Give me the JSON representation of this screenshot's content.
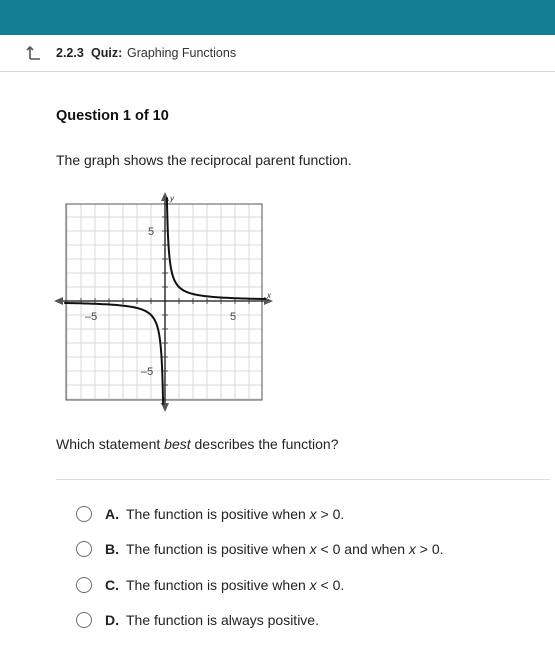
{
  "header": {
    "lesson_number": "2.2.3",
    "quiz_label": "Quiz:",
    "title": "Graphing Functions"
  },
  "question": {
    "heading": "Question 1 of 10",
    "prompt": "The graph shows the reciprocal parent function.",
    "stem_before": "Which statement ",
    "stem_emphasis": "best",
    "stem_after": " describes the function?"
  },
  "graph": {
    "x_axis_label": "x",
    "y_axis_label": "y",
    "tick_labels": {
      "x_neg": "–5",
      "x_pos": "5",
      "y_pos": "5",
      "y_neg": "–5"
    },
    "function": "1/x"
  },
  "options": [
    {
      "letter": "A.",
      "text_before": "The function is positive when ",
      "var1": "x",
      "text_mid": " > 0.",
      "var2": "",
      "text_after": ""
    },
    {
      "letter": "B.",
      "text_before": "The function is positive when ",
      "var1": "x",
      "text_mid": " < 0 and when ",
      "var2": "x",
      "text_after": " > 0."
    },
    {
      "letter": "C.",
      "text_before": "The function is positive when ",
      "var1": "x",
      "text_mid": " < 0.",
      "var2": "",
      "text_after": ""
    },
    {
      "letter": "D.",
      "text_before": "The function is always positive.",
      "var1": "",
      "text_mid": "",
      "var2": "",
      "text_after": ""
    }
  ],
  "colors": {
    "topbar": "#127f96",
    "grid": "#cfcfcf",
    "axis": "#111111"
  }
}
